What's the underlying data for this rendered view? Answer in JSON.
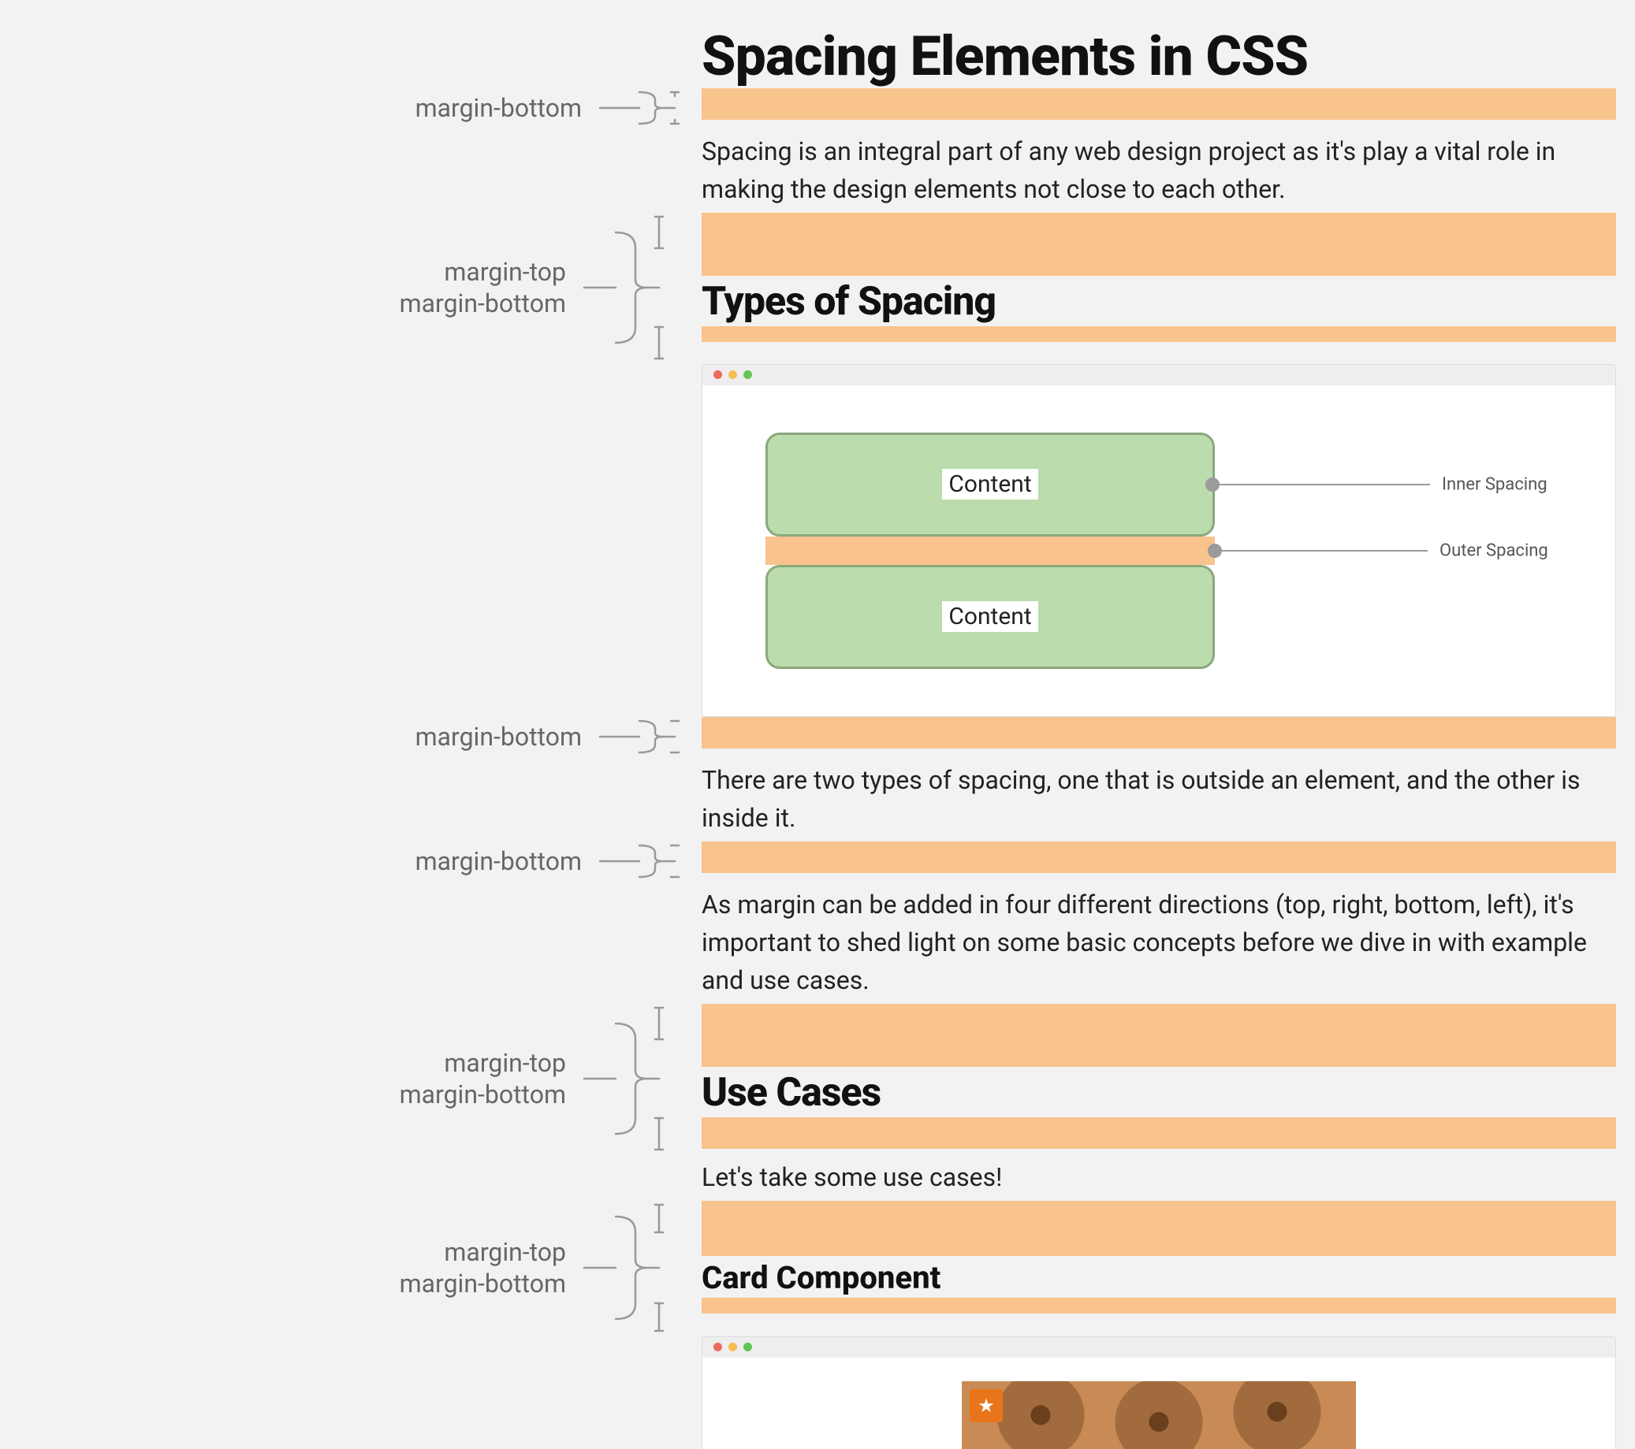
{
  "labels": {
    "margin_bottom": "margin-bottom",
    "margin_top_bottom_line1": "margin-top",
    "margin_top_bottom_line2": "margin-bottom"
  },
  "article": {
    "title": "Spacing Elements in CSS",
    "intro": "Spacing is an integral part of any web design project as it's play a vital role in making the design elements not close to each other.",
    "h2_types": "Types of Spacing",
    "figure1": {
      "box1_label": "Content",
      "box2_label": "Content",
      "inner_spacing_label": "Inner Spacing",
      "outer_spacing_label": "Outer Spacing"
    },
    "p_types_desc": "There are two types of spacing, one that is outside an element, and the other is inside it.",
    "p_margin_directions": "As margin can be added in four different directions (top, right, bottom, left), it's important to shed light on some basic concepts before we dive in with example and use cases.",
    "h2_use_cases": "Use Cases",
    "p_use_cases_intro": "Let's take some use cases!",
    "h3_card": "Card Component"
  },
  "colors": {
    "margin_highlight": "#f8c38d",
    "inner_box": "#bbdcac"
  }
}
